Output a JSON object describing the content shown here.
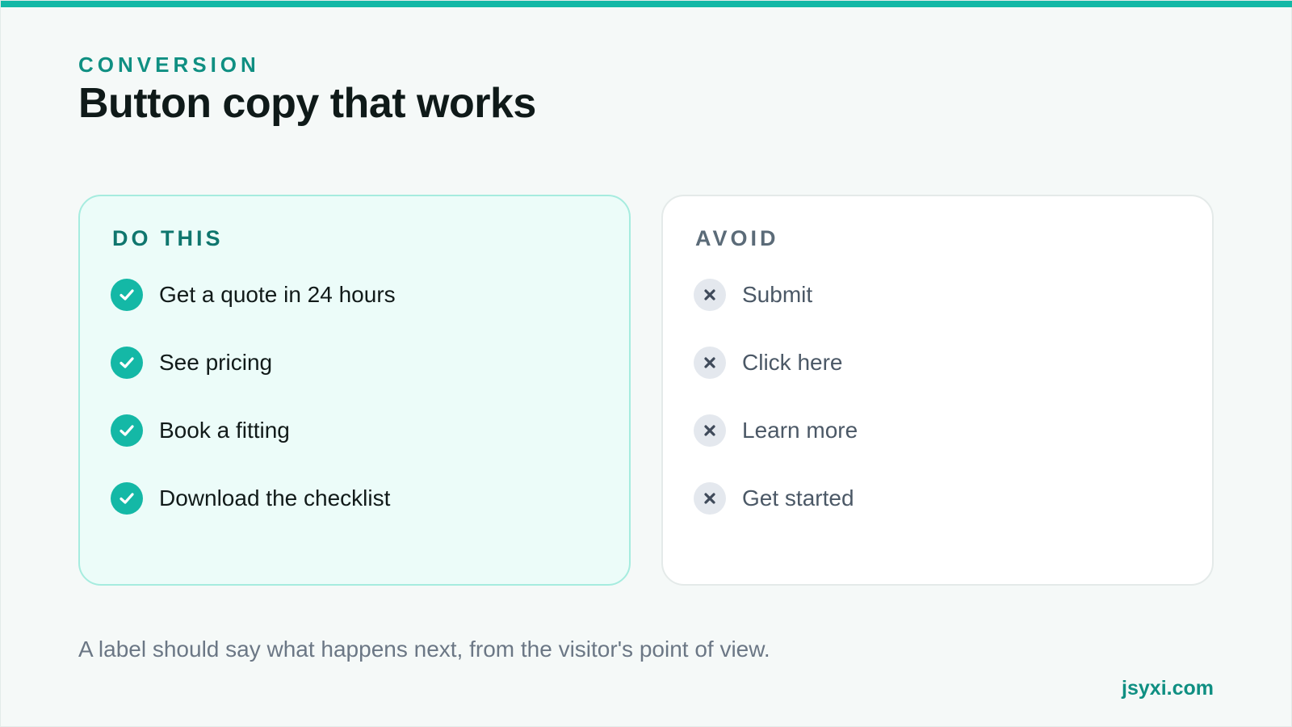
{
  "header": {
    "eyebrow": "CONVERSION",
    "title": "Button copy that works"
  },
  "do_card": {
    "heading": "DO THIS",
    "icon": "check-circle-icon",
    "items": [
      "Get a quote in 24 hours",
      "See pricing",
      "Book a fitting",
      "Download the checklist"
    ]
  },
  "avoid_card": {
    "heading": "AVOID",
    "icon": "x-circle-icon",
    "items": [
      "Submit",
      "Click here",
      "Learn more",
      "Get started"
    ]
  },
  "caption": "A label should say what happens next, from the visitor's point of view.",
  "brand": "jsyxi.com",
  "colors": {
    "accent": "#14b8a6",
    "accent_dark": "#0f8f82",
    "do_card_bg": "#ecfcf9",
    "avoid_badge_bg": "#e4e8ee",
    "avoid_icon": "#3f4a5a"
  }
}
